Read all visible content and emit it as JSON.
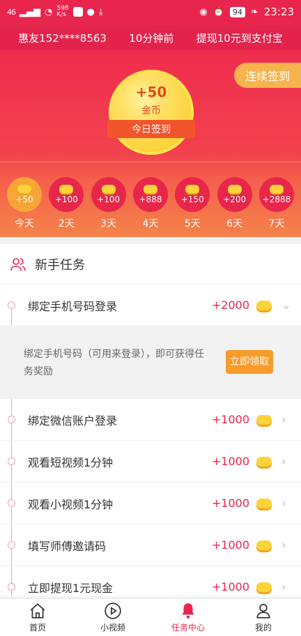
{
  "status_bar": {
    "signal": "46",
    "speed_value": "598",
    "speed_unit": "K/s",
    "battery": "94",
    "time": "23:23"
  },
  "ticker": {
    "user": "惠友152****8563",
    "time_ago": "10分钟前",
    "action": "提现10元到支付宝"
  },
  "signin": {
    "continuous_button": "连续签到",
    "coin_amount": "+50",
    "coin_unit": "金币",
    "today_label": "今日签到"
  },
  "days": [
    {
      "reward": "+50",
      "label": "今天"
    },
    {
      "reward": "+100",
      "label": "2天"
    },
    {
      "reward": "+100",
      "label": "3天"
    },
    {
      "reward": "+888",
      "label": "4天"
    },
    {
      "reward": "+150",
      "label": "5天"
    },
    {
      "reward": "+200",
      "label": "6天"
    },
    {
      "reward": "+2888",
      "label": "7天"
    }
  ],
  "tasks": {
    "section_title": "新手任务",
    "items": [
      {
        "name": "绑定手机号码登录",
        "reward": "+2000"
      },
      {
        "name": "绑定微信账户登录",
        "reward": "+1000"
      },
      {
        "name": "观看短视频1分钟",
        "reward": "+1000"
      },
      {
        "name": "观看小视频1分钟",
        "reward": "+1000"
      },
      {
        "name": "填写师傅邀请码",
        "reward": "+1000"
      },
      {
        "name": "立即提现1元现金",
        "reward": "+1000"
      }
    ],
    "detail_text": "绑定手机号码（可用来登录），即可获得任务奖励",
    "claim_button": "立即领取"
  },
  "nav": {
    "home": "首页",
    "short_video": "小视频",
    "task_center": "任务中心",
    "mine": "我的"
  },
  "colors": {
    "primary": "#e8254d",
    "accent": "#f79c2a"
  }
}
